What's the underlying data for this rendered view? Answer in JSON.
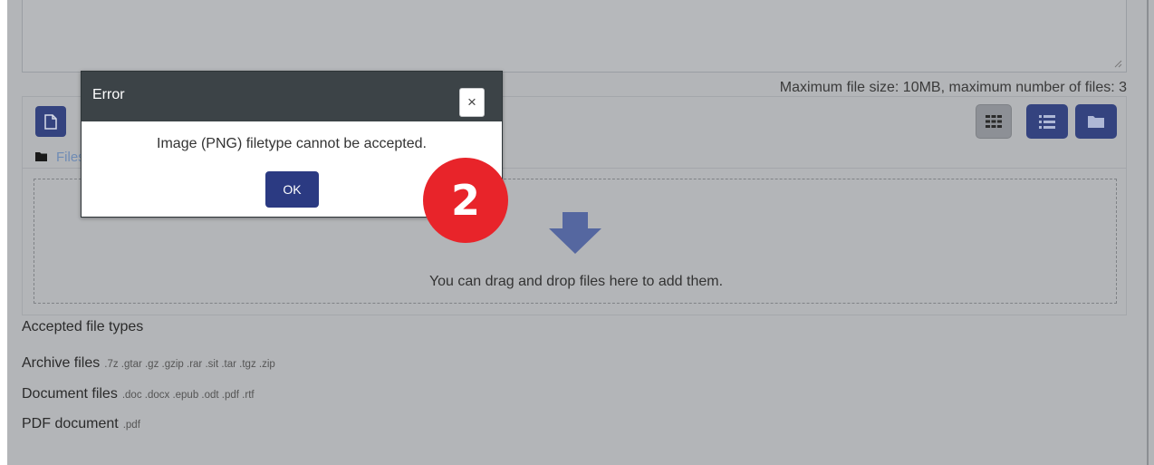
{
  "upload": {
    "max_info": "Maximum file size: 10MB, maximum number of files: 3",
    "path_label": "Files",
    "drop_text": "You can drag and drop files here to add them."
  },
  "accepted_types": {
    "title": "Accepted file types",
    "rows": [
      {
        "label": "Archive files",
        "extensions": ".7z .gtar .gz .gzip .rar .sit .tar .tgz .zip"
      },
      {
        "label": "Document files",
        "extensions": ".doc .docx .epub .odt .pdf .rtf"
      },
      {
        "label": "PDF document",
        "extensions": ".pdf"
      }
    ]
  },
  "dialog": {
    "title": "Error",
    "close_symbol": "×",
    "message": "Image (PNG) filetype cannot be accepted.",
    "ok_label": "OK"
  },
  "annotation": {
    "step_number": "2"
  },
  "icons": {
    "add_file": "file-icon",
    "grid_view": "grid-icon",
    "list_view": "list-icon",
    "tree_view": "folder-icon",
    "path_folder": "folder-icon",
    "drop_arrow": "arrow-down-icon"
  },
  "colors": {
    "primary_button": "#34437f",
    "dialog_header": "#3c4347",
    "badge": "#e8242a"
  }
}
